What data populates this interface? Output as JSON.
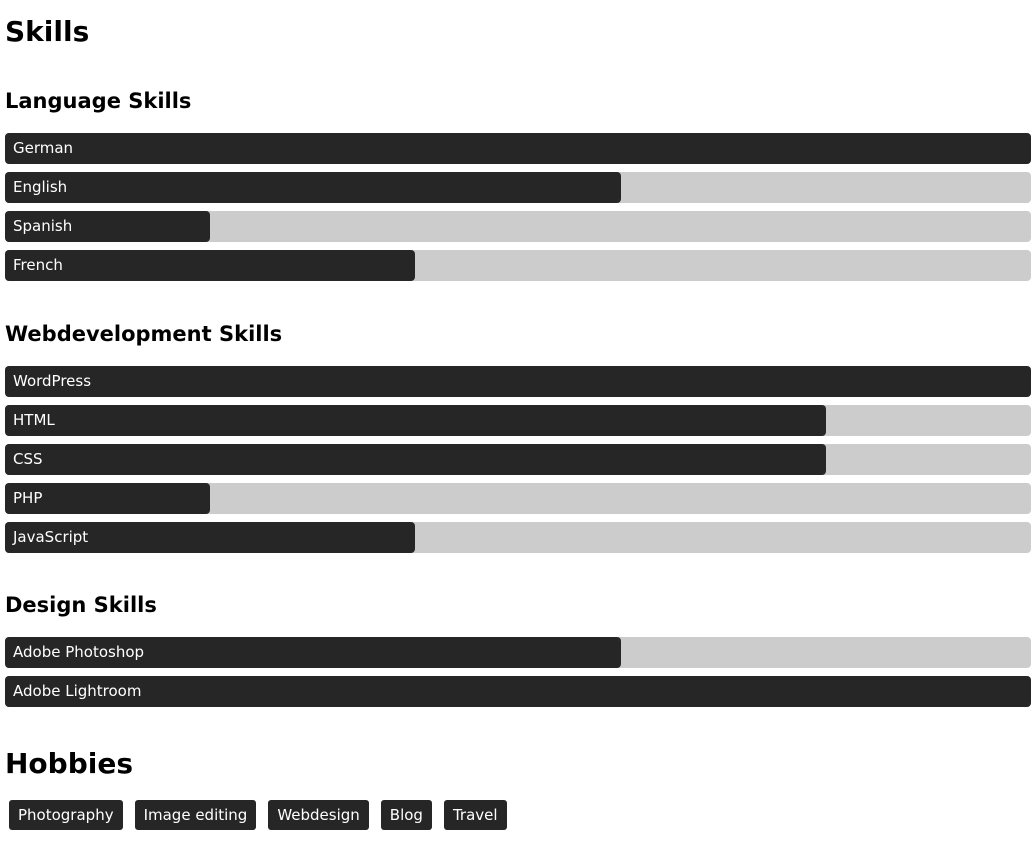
{
  "page_title": "Skills",
  "colors": {
    "bar_fill": "#262626",
    "bar_track": "#cccccc",
    "bar_text": "#ffffff",
    "tag_bg": "#262626",
    "tag_text": "#ffffff"
  },
  "language_skills": {
    "title": "Language Skills",
    "items": [
      {
        "label": "German",
        "percent": 100
      },
      {
        "label": "English",
        "percent": 60
      },
      {
        "label": "Spanish",
        "percent": 20
      },
      {
        "label": "French",
        "percent": 40
      }
    ]
  },
  "web_skills": {
    "title": "Webdevelopment Skills",
    "items": [
      {
        "label": "WordPress",
        "percent": 100
      },
      {
        "label": "HTML",
        "percent": 80
      },
      {
        "label": "CSS",
        "percent": 80
      },
      {
        "label": "PHP",
        "percent": 20
      },
      {
        "label": "JavaScript",
        "percent": 40
      }
    ]
  },
  "design_skills": {
    "title": "Design Skills",
    "items": [
      {
        "label": "Adobe Photoshop",
        "percent": 60
      },
      {
        "label": "Adobe Lightroom",
        "percent": 100
      }
    ]
  },
  "hobbies": {
    "title": "Hobbies",
    "items": [
      "Photography",
      "Image editing",
      "Webdesign",
      "Blog",
      "Travel"
    ]
  }
}
